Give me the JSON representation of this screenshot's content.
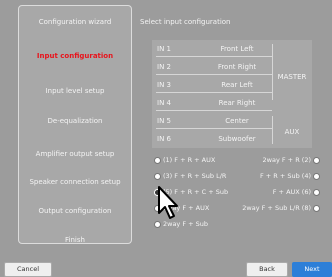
{
  "sidebar": {
    "items": [
      {
        "label": "Configuration wizard",
        "active": false
      },
      {
        "label": "Input configuration",
        "active": true
      },
      {
        "label": "Input level setup",
        "active": false
      },
      {
        "label": "De-equalization",
        "active": false
      },
      {
        "label": "Amplifier output setup",
        "active": false
      },
      {
        "label": "Speaker connection setup",
        "active": false
      },
      {
        "label": "Output configuration",
        "active": false
      },
      {
        "label": "Finish",
        "active": false
      }
    ]
  },
  "main": {
    "title": "Select input configuration",
    "table": {
      "rows": [
        {
          "channel": "IN 1",
          "name": "Front Left"
        },
        {
          "channel": "IN 2",
          "name": "Front Right"
        },
        {
          "channel": "IN 3",
          "name": "Rear Left"
        },
        {
          "channel": "IN 4",
          "name": "Rear Right"
        },
        {
          "channel": "IN 5",
          "name": "Center"
        },
        {
          "channel": "IN 6",
          "name": "Subwoofer"
        }
      ],
      "groups": [
        "MASTER",
        "AUX"
      ]
    },
    "options": {
      "left": [
        {
          "label": "(1) F + R + AUX",
          "selected": false
        },
        {
          "label": "(3) F + R + Sub L/R",
          "selected": false
        },
        {
          "label": "(5) F + R + C + Sub",
          "selected": true
        },
        {
          "label": "2way F + AUX",
          "selected": false
        },
        {
          "label": "2way F + Sub",
          "selected": false
        }
      ],
      "right": [
        {
          "label": "2way F + R (2)",
          "selected": false
        },
        {
          "label": "F + R + Sub (4)",
          "selected": false
        },
        {
          "label": "F + AUX (6)",
          "selected": false
        },
        {
          "label": "2way F + Sub L/R (8)",
          "selected": false
        }
      ]
    }
  },
  "footer": {
    "cancel_label": "Cancel",
    "back_label": "Back",
    "next_label": "Next"
  },
  "colors": {
    "background": "#9c9c9c",
    "panel": "#a8a8a8",
    "active_text": "#e8141c",
    "primary_button": "#2d7fd8"
  }
}
